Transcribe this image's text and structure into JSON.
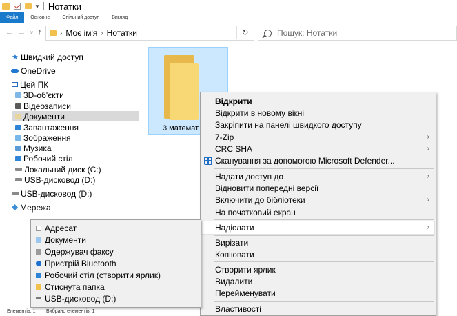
{
  "window": {
    "title": "Нотатки"
  },
  "ribbon": {
    "tabs": [
      "Файл",
      "Основне",
      "Спільний доступ",
      "Вигляд"
    ]
  },
  "address": {
    "path": [
      "Моє ім'я",
      "Нотатки"
    ],
    "search_placeholder": "Пошук: Нотатки"
  },
  "nav": {
    "items": [
      {
        "label": "Швидкий доступ",
        "icon": "star-icon"
      },
      {
        "label": "OneDrive",
        "icon": "cloud-icon"
      },
      {
        "label": "Цей ПК",
        "icon": "computer-icon"
      },
      {
        "label": "3D-об'єкти",
        "icon": "objects3d-icon"
      },
      {
        "label": "Відеозаписи",
        "icon": "video-folder-icon"
      },
      {
        "label": "Документи",
        "icon": "documents-folder-icon"
      },
      {
        "label": "Завантаження",
        "icon": "downloads-folder-icon"
      },
      {
        "label": "Зображення",
        "icon": "pictures-folder-icon"
      },
      {
        "label": "Музика",
        "icon": "music-folder-icon"
      },
      {
        "label": "Робочий стіл",
        "icon": "desktop-folder-icon"
      },
      {
        "label": "Локальний диск (C:)",
        "icon": "drive-icon"
      },
      {
        "label": "USB-дисковод (D:)",
        "icon": "usb-drive-icon"
      },
      {
        "label": "USB-дисковод (D:)",
        "icon": "usb-drive-icon"
      },
      {
        "label": "Мережа",
        "icon": "network-icon"
      }
    ],
    "selected": "Документи"
  },
  "content": {
    "folder_name": "3 математ"
  },
  "context_menu": {
    "items": [
      {
        "label": "Відкрити",
        "bold": true
      },
      {
        "label": "Відкрити в новому вікні"
      },
      {
        "label": "Закріпити на панелі швидкого доступу"
      },
      {
        "label": "7-Zip",
        "submenu": true
      },
      {
        "label": "CRC SHA",
        "submenu": true
      },
      {
        "label": "Сканування за допомогою Microsoft Defender...",
        "icon": "defender-icon"
      },
      {
        "label": "Надати доступ до",
        "submenu": true
      },
      {
        "label": "Відновити попередні версії"
      },
      {
        "label": "Включити до бібліотеки",
        "submenu": true
      },
      {
        "label": "На початковий екран"
      },
      {
        "label": "Надіслати",
        "submenu": true,
        "highlighted": true
      },
      {
        "label": "Вирізати"
      },
      {
        "label": "Копіювати"
      },
      {
        "label": "Створити ярлик"
      },
      {
        "label": "Видалити"
      },
      {
        "label": "Перейменувати"
      },
      {
        "label": "Властивості"
      }
    ]
  },
  "sendto_menu": {
    "items": [
      {
        "label": "Адресат",
        "icon": "recipient-icon"
      },
      {
        "label": "Документи",
        "icon": "documents-icon"
      },
      {
        "label": "Одержувач факсу",
        "icon": "fax-icon"
      },
      {
        "label": "Пристрій Bluetooth",
        "icon": "bluetooth-icon"
      },
      {
        "label": "Робочий стіл (створити ярлик)",
        "icon": "desktop-icon"
      },
      {
        "label": "Стиснута папка",
        "icon": "zip-folder-icon"
      },
      {
        "label": "USB-дисковод (D:)",
        "icon": "usb-drive-icon"
      }
    ]
  },
  "status": {
    "items_count": "Елементів: 1",
    "selected_count": "Вибрано елементів: 1"
  },
  "colors": {
    "accent": "#1979ca",
    "selection": "#cce8ff",
    "folder": "#f8d775"
  }
}
